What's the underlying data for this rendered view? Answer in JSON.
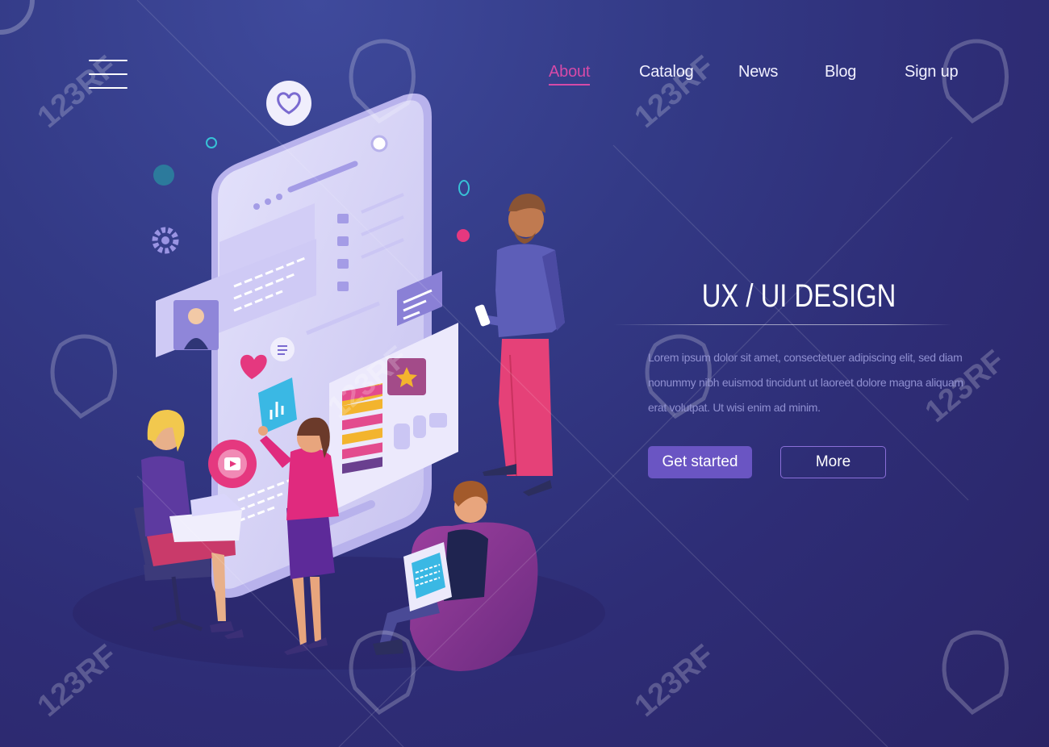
{
  "nav": {
    "menu_icon": "hamburger-menu-icon",
    "items": [
      {
        "label": "About",
        "active": true
      },
      {
        "label": "Catalog",
        "active": false
      },
      {
        "label": "News",
        "active": false
      },
      {
        "label": "Blog",
        "active": false
      },
      {
        "label": "Sign up",
        "active": false
      }
    ]
  },
  "hero": {
    "title": "UX / UI DESIGN",
    "description": "Lorem ipsum dolor sit amet, consectetuer adipiscing elit, sed diam nonummy nibh euismod tincidunt ut laoreet dolore magna aliquam erat volutpat. Ut wisi enim ad minim.",
    "primary_button": "Get started",
    "secondary_button": "More"
  },
  "watermark": {
    "text": "123RF"
  },
  "colors": {
    "background": "#2e2d76",
    "accent": "#d64aa8",
    "button": "#6a55c3",
    "muted_text": "#8f8fd0"
  }
}
